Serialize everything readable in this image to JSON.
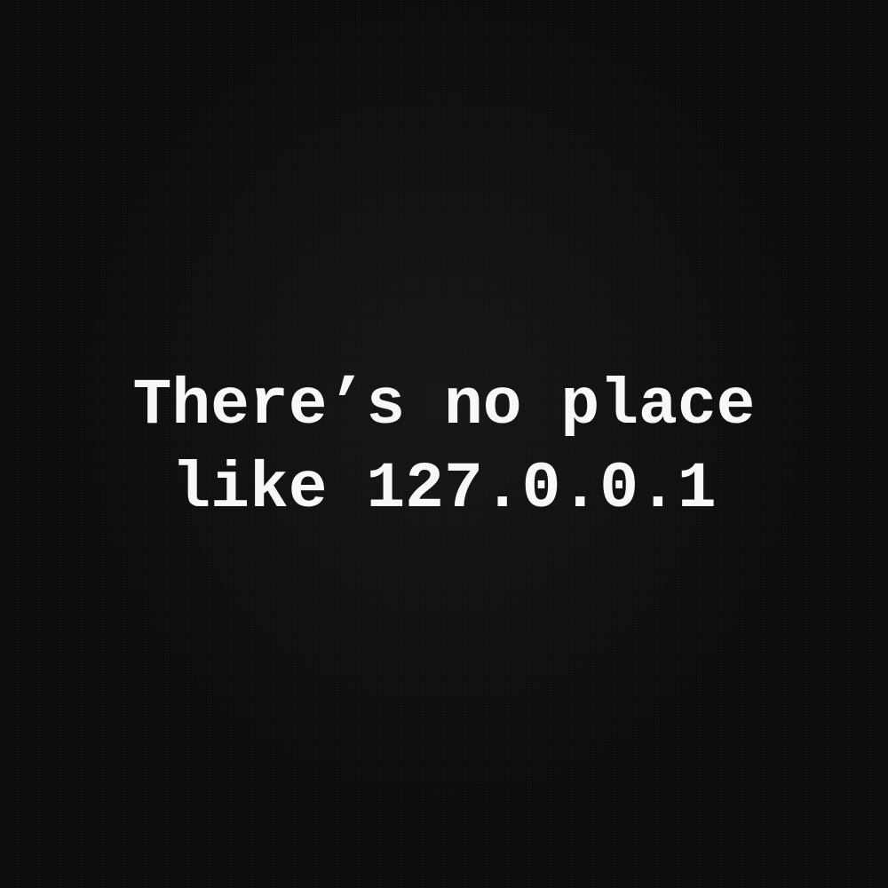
{
  "print": {
    "line1": "There’s no place",
    "line2": "like 127.0.0.1",
    "text_color": "#f8f8f8",
    "background_color": "#0c0c0c"
  }
}
